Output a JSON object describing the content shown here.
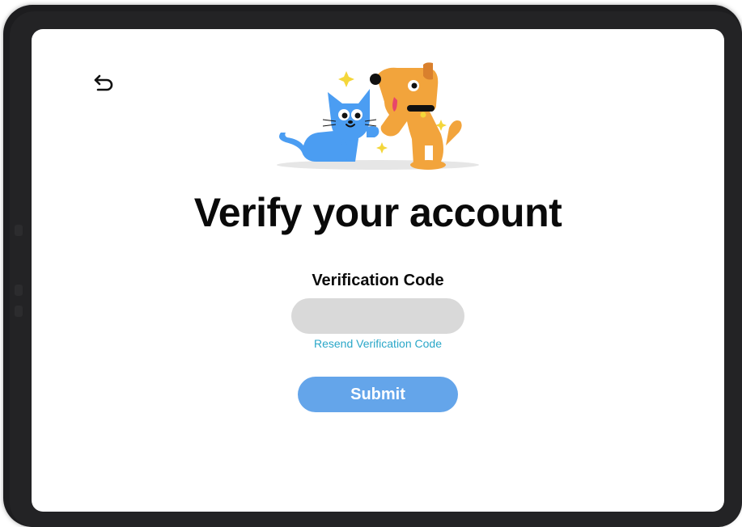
{
  "header": {
    "back_icon": "undo-arrow-icon"
  },
  "illustration": {
    "icons": [
      "cat-icon",
      "dog-icon",
      "sparkle-icon"
    ],
    "colors": {
      "cat": "#4b9df2",
      "dog": "#f2a43c",
      "sparkle": "#f4d63a",
      "shadow": "#e6e6e6"
    }
  },
  "main": {
    "title": "Verify your account",
    "code_label": "Verification Code",
    "code_value": "",
    "resend_label": "Resend Verification Code",
    "submit_label": "Submit"
  },
  "colors": {
    "input_bg": "#d9d9d9",
    "link": "#2aa7c8",
    "button": "#64a5ea"
  }
}
